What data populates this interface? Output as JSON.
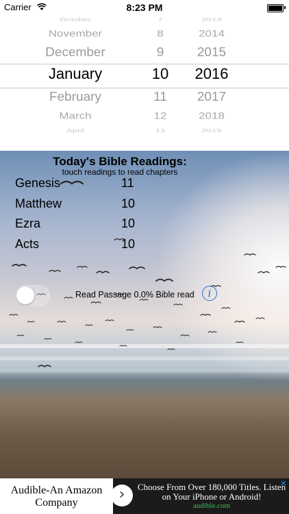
{
  "status_bar": {
    "carrier": "Carrier",
    "time": "8:23 PM"
  },
  "picker": {
    "rows": [
      {
        "month": "October",
        "day": "7",
        "year": "2013"
      },
      {
        "month": "November",
        "day": "8",
        "year": "2014"
      },
      {
        "month": "December",
        "day": "9",
        "year": "2015"
      },
      {
        "month": "January",
        "day": "10",
        "year": "2016"
      },
      {
        "month": "February",
        "day": "11",
        "year": "2017"
      },
      {
        "month": "March",
        "day": "12",
        "year": "2018"
      },
      {
        "month": "April",
        "day": "13",
        "year": "2019"
      }
    ],
    "selected_index": 3
  },
  "readings": {
    "title": "Today's Bible Readings:",
    "subtitle": "touch readings to read chapters",
    "items": [
      {
        "book": "Genesis",
        "chapter": "11"
      },
      {
        "book": "Matthew",
        "chapter": "10"
      },
      {
        "book": "Ezra",
        "chapter": "10"
      },
      {
        "book": "Acts",
        "chapter": "10"
      }
    ]
  },
  "controls": {
    "status_text": "Read Passage 0.0% Bible read",
    "toggle_on": false,
    "info_label": "i"
  },
  "ad": {
    "left_line1": "Audible-An Amazon",
    "left_line2": "Company",
    "chevron": "›",
    "text": "Choose From Over 180,000 Titles. Listen on Your iPhone or Android!",
    "url": "audible.com",
    "close": "✕"
  },
  "colors": {
    "info_blue": "#1f6fd8",
    "ad_url_green": "#3fc05c"
  }
}
